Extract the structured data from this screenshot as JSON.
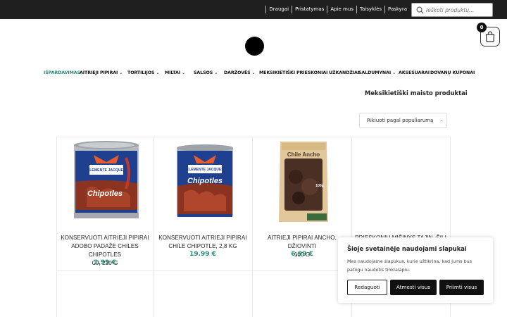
{
  "topbar": {
    "links": [
      "Draugai",
      "Pristatymas",
      "Apie mus",
      "Taisyklės",
      "Paskyra"
    ],
    "search_placeholder": "Ieškoti produktų..."
  },
  "cart": {
    "count": "0"
  },
  "nav": {
    "items": [
      {
        "label": "IŠPARDAVIMAS",
        "dropdown": false
      },
      {
        "label": "AITRIEJI PIPIRAI",
        "dropdown": true
      },
      {
        "label": "TORTILIJOS",
        "dropdown": true
      },
      {
        "label": "MILTAI",
        "dropdown": true
      },
      {
        "label": "SALSOS",
        "dropdown": true
      },
      {
        "label": "DARŽOVĖS",
        "dropdown": true
      },
      {
        "label": "MEKSIKIETIŠKI PRIESKONIAI",
        "dropdown": true
      },
      {
        "label": "UŽKANDŽIAI",
        "dropdown": false
      },
      {
        "label": "SALDUMYNAI",
        "dropdown": true
      },
      {
        "label": "AKSESUARAI",
        "dropdown": false
      },
      {
        "label": "DOVANŲ KUPONAI",
        "dropdown": false
      }
    ]
  },
  "category": {
    "title": "Meksikietiški maisto produktai",
    "sort_label": "Rikiuoti pagal populiarumą"
  },
  "products": [
    {
      "name_line1": "KONSERVUOTI AITRIEJI PIPIRAI",
      "name_line2": "ADOBO PADAŽE CHILES CHIPOTLES",
      "name_line3": "CJ, 220 G",
      "price": "2.99 €",
      "image": "chipotles-can-small",
      "image_label": "Chipotles",
      "brand": "CLEMENTE JACQUES"
    },
    {
      "name_line1": "KONSERVUOTI AITRIEJI PIPIRAI",
      "name_line2": "CHILE CHIPOTLE, 2,8 KG",
      "name_line3": "",
      "price": "19.99 €",
      "image": "chipotles-can-large",
      "image_label": "Chipotles",
      "brand": "CLEMENTE JACQUES"
    },
    {
      "name_line1": "AITRIEJI PIPIRAI ANCHO, DŽIOVINTI",
      "name_line2": "100 G",
      "name_line3": "",
      "price": "6.99 €",
      "image": "chile-ancho-bag",
      "image_label": "Chile Ancho",
      "weight": "100g"
    },
    {
      "name_line1": "PRIESKONIŲ MIŠINYS TAJIN, ŠILI",
      "name_line2": "",
      "name_line3": "",
      "price": "",
      "image": "",
      "image_label": ""
    }
  ],
  "cookie": {
    "title": "Šioje svetainėje naudojami slapukai",
    "text": "Mes naudojame slapukus, kurie užtikrina, kad Jums bus patogu naudotis tinklalapiu.",
    "customize": "Redaguoti",
    "reject": "Atmesti visus",
    "accept": "Priimti visus"
  },
  "colors": {
    "accent": "#2a8a73",
    "topbar": "#1f1f1f"
  }
}
